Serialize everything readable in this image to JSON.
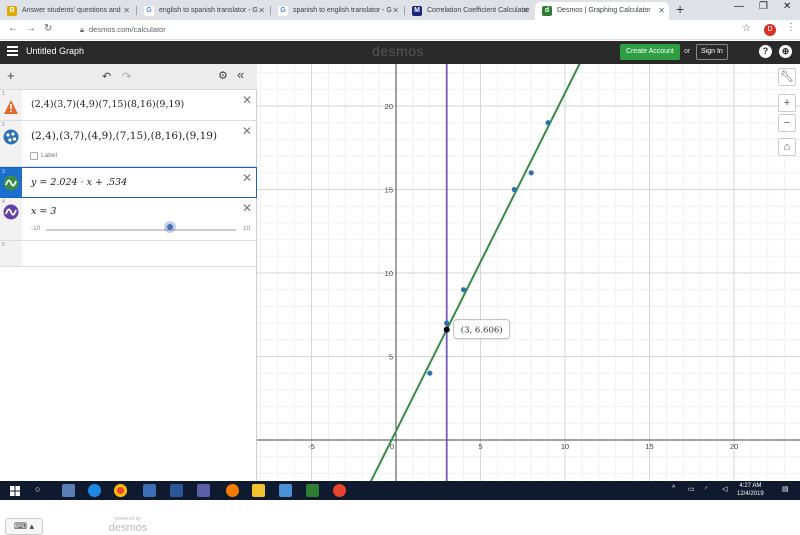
{
  "browser": {
    "tabs": [
      {
        "title": "Answer students' questions and",
        "favicon": "B",
        "favicon_color": "#e0a800"
      },
      {
        "title": "english to spanish translator - G",
        "favicon": "G",
        "favicon_color": "#4285f4"
      },
      {
        "title": "spanish to english translator - G",
        "favicon": "G",
        "favicon_color": "#4285f4"
      },
      {
        "title": "Correlation Coefficient Calculator",
        "favicon": "M",
        "favicon_color": "#1a237e"
      },
      {
        "title": "Desmos | Graphing Calculator",
        "favicon": "d",
        "favicon_color": "#2e7d32"
      }
    ],
    "new_tab": "+",
    "url": "desmos.com/calculator",
    "profile_initial": "D"
  },
  "header": {
    "graph_title": "Untitled Graph",
    "logo": "desmos",
    "create_account": "Create Account",
    "or": "or",
    "sign_in": "Sign In",
    "help": "?",
    "globe": "⊕"
  },
  "toolbar": {
    "add": "+",
    "undo": "↶",
    "redo": "↷",
    "settings": "⚙",
    "collapse": "«"
  },
  "expressions": [
    {
      "num": "1",
      "text": "(2,4)(3,7)(4,9)(7,15)(8,16)(9,19)",
      "icon": "warning-icon",
      "color": "#e3692a"
    },
    {
      "num": "2",
      "text": "(2,4),(3,7),(4,9),(7,15),(8,16),(9,19)",
      "icon": "points-icon",
      "color": "#2d70b3",
      "label": "Label"
    },
    {
      "num": "3",
      "text": "y = 2.024 · x + .534",
      "icon": "wave-icon",
      "color": "#388c46"
    },
    {
      "num": "4",
      "text": "x = 3",
      "icon": "wave-icon",
      "color": "#6042a6",
      "slider_min": "-10",
      "slider_max": "10"
    },
    {
      "num": "5"
    }
  ],
  "footer": {
    "keyboard": "⌨ ▴",
    "powered_by": "powered by",
    "logo": "desmos"
  },
  "graph": {
    "x_ticks": [
      "-5",
      "0",
      "5",
      "10",
      "15",
      "20"
    ],
    "y_ticks": [
      "5",
      "10",
      "15",
      "20"
    ],
    "tooltip": "(3, 6.606)",
    "point_color": "#2d70b3",
    "line_color": "#388c46",
    "vline_color": "#6042a6",
    "points": [
      [
        2,
        4
      ],
      [
        3,
        7
      ],
      [
        4,
        9
      ],
      [
        7,
        15
      ],
      [
        8,
        16
      ],
      [
        9,
        19
      ]
    ],
    "line": {
      "slope": 2.024,
      "intercept": 0.534
    },
    "vline_x": 3,
    "highlight": [
      3,
      6.606
    ]
  },
  "right_tools": {
    "wrench": "🔧",
    "zoom_in": "+",
    "zoom_out": "−",
    "home": "⌂"
  },
  "taskbar": {
    "time": "4:27 AM",
    "date": "12/4/2019"
  }
}
